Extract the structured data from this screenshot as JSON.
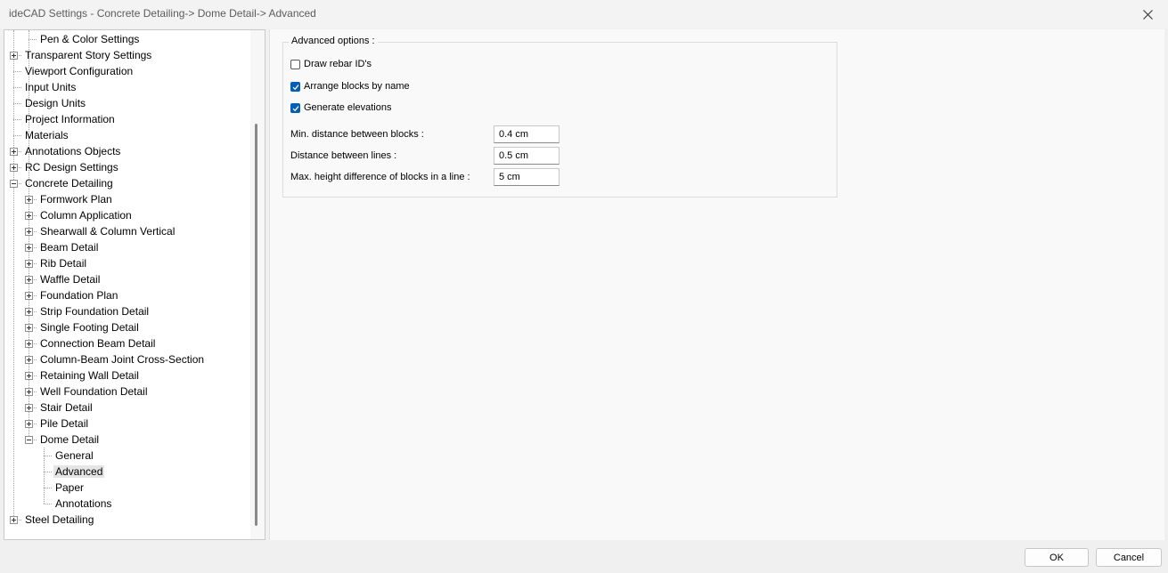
{
  "window": {
    "title": "ideCAD Settings - Concrete Detailing-> Dome Detail-> Advanced"
  },
  "tree": {
    "items": [
      {
        "label": "Pen & Color Settings",
        "level": 1,
        "expander": "none"
      },
      {
        "label": "Transparent Story Settings",
        "level": 0,
        "expander": "plus"
      },
      {
        "label": "Viewport Configuration",
        "level": 0,
        "expander": "none"
      },
      {
        "label": "Input Units",
        "level": 0,
        "expander": "none"
      },
      {
        "label": "Design Units",
        "level": 0,
        "expander": "none"
      },
      {
        "label": "Project Information",
        "level": 0,
        "expander": "none"
      },
      {
        "label": "Materials",
        "level": 0,
        "expander": "none"
      },
      {
        "label": "Annotations Objects",
        "level": 0,
        "expander": "plus"
      },
      {
        "label": "RC Design Settings",
        "level": 0,
        "expander": "plus"
      },
      {
        "label": "Concrete Detailing",
        "level": 0,
        "expander": "minus"
      },
      {
        "label": "Formwork Plan",
        "level": 1,
        "expander": "plus"
      },
      {
        "label": "Column Application",
        "level": 1,
        "expander": "plus"
      },
      {
        "label": "Shearwall & Column Vertical",
        "level": 1,
        "expander": "plus"
      },
      {
        "label": "Beam Detail",
        "level": 1,
        "expander": "plus"
      },
      {
        "label": "Rib Detail",
        "level": 1,
        "expander": "plus"
      },
      {
        "label": "Waffle Detail",
        "level": 1,
        "expander": "plus"
      },
      {
        "label": "Foundation Plan",
        "level": 1,
        "expander": "plus"
      },
      {
        "label": "Strip Foundation Detail",
        "level": 1,
        "expander": "plus"
      },
      {
        "label": "Single Footing Detail",
        "level": 1,
        "expander": "plus"
      },
      {
        "label": "Connection Beam Detail",
        "level": 1,
        "expander": "plus"
      },
      {
        "label": "Column-Beam Joint Cross-Section",
        "level": 1,
        "expander": "plus"
      },
      {
        "label": "Retaining Wall Detail",
        "level": 1,
        "expander": "plus"
      },
      {
        "label": "Well Foundation Detail",
        "level": 1,
        "expander": "plus"
      },
      {
        "label": "Stair Detail",
        "level": 1,
        "expander": "plus"
      },
      {
        "label": "Pile Detail",
        "level": 1,
        "expander": "plus"
      },
      {
        "label": "Dome Detail",
        "level": 1,
        "expander": "minus"
      },
      {
        "label": "General",
        "level": 2,
        "expander": "none"
      },
      {
        "label": "Advanced",
        "level": 2,
        "expander": "none",
        "selected": true
      },
      {
        "label": "Paper",
        "level": 2,
        "expander": "none"
      },
      {
        "label": "Annotations",
        "level": 2,
        "expander": "none"
      },
      {
        "label": "Steel Detailing",
        "level": 0,
        "expander": "plus"
      }
    ]
  },
  "advanced": {
    "group_title": "Advanced options :",
    "checkboxes": [
      {
        "label": "Draw rebar ID's",
        "checked": false
      },
      {
        "label": "Arrange blocks by name",
        "checked": true
      },
      {
        "label": "Generate elevations",
        "checked": true
      }
    ],
    "fields": [
      {
        "label": "Min. distance between blocks :",
        "value": "0.4 cm"
      },
      {
        "label": "Distance between lines :",
        "value": "0.5 cm"
      },
      {
        "label": "Max. height difference of blocks in a line :",
        "value": "5 cm"
      }
    ]
  },
  "footer": {
    "ok_label": "OK",
    "cancel_label": "Cancel"
  },
  "colors": {
    "accent": "#005fb8",
    "selection": "#e5e5e5"
  }
}
